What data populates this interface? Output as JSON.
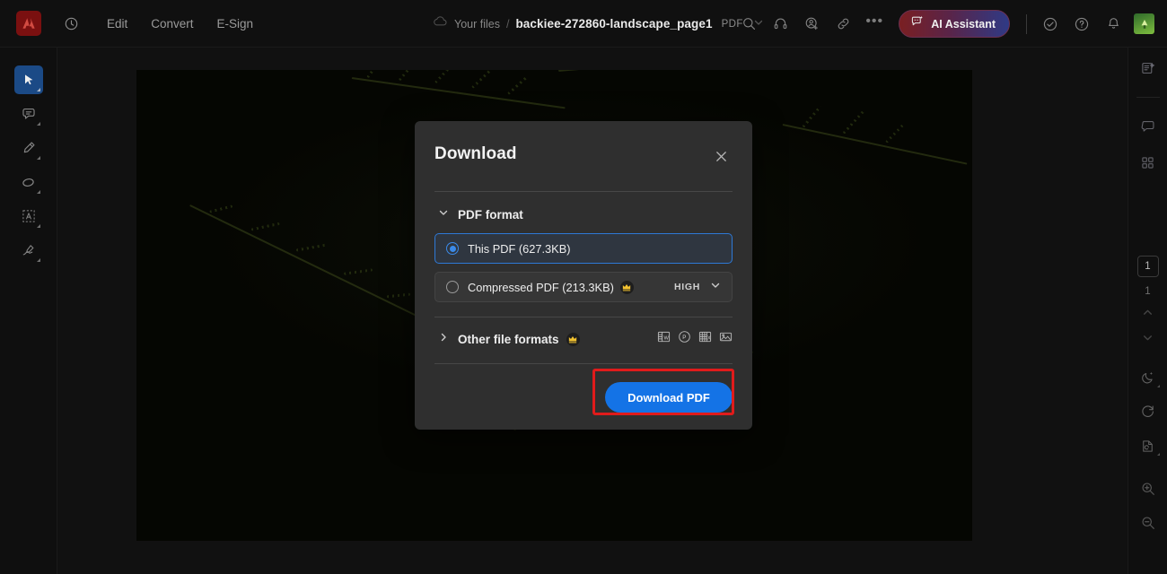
{
  "app": {
    "name": "Adobe Acrobat",
    "logo_icon": "adobe-logo-icon",
    "accent_blue": "#1473e6",
    "highlight_red": "#e01b1b",
    "modal_bg": "#2f2f2f"
  },
  "topbar": {
    "history_icon": "history-clock-icon",
    "menus": [
      {
        "label": "Edit",
        "name": "menu-edit"
      },
      {
        "label": "Convert",
        "name": "menu-convert"
      },
      {
        "label": "E-Sign",
        "name": "menu-esign"
      }
    ],
    "breadcrumb": {
      "cloud_icon": "cloud-icon",
      "root": "Your files",
      "separator": "/",
      "filename": "backiee-272860-landscape_page1",
      "filetype": "PDF",
      "chevron_icon": "chevron-down-icon"
    },
    "actions": [
      {
        "name": "search-icon",
        "icon": "search-icon"
      },
      {
        "name": "support-headset-icon",
        "icon": "headset-icon"
      },
      {
        "name": "add-person-icon",
        "icon": "person-add-icon"
      },
      {
        "name": "share-link-icon",
        "icon": "link-icon"
      },
      {
        "name": "more-options-icon",
        "icon": "ellipsis-icon",
        "label": "•••"
      }
    ],
    "ai_button": {
      "label": "AI Assistant",
      "icon": "ai-sparkle-chat-icon"
    },
    "right_actions": [
      {
        "name": "tasks-check-icon",
        "icon": "check-circle-icon"
      },
      {
        "name": "help-icon",
        "icon": "question-circle-icon"
      },
      {
        "name": "notifications-icon",
        "icon": "bell-icon"
      }
    ],
    "avatar": {
      "name": "user-avatar",
      "initial": ""
    }
  },
  "left_toolbar": {
    "tools": [
      {
        "name": "select-tool",
        "icon": "cursor-arrow-icon",
        "active": true
      },
      {
        "name": "comment-tool",
        "icon": "comment-bubble-icon",
        "active": false
      },
      {
        "name": "highlight-tool",
        "icon": "highlighter-pen-icon",
        "active": false
      },
      {
        "name": "draw-tool",
        "icon": "ellipse-draw-icon",
        "active": false
      },
      {
        "name": "text-box-tool",
        "icon": "text-box-a-icon",
        "active": false
      },
      {
        "name": "sign-tool",
        "icon": "signature-pen-icon",
        "active": false
      }
    ]
  },
  "right_toolbar": {
    "top_icons": [
      {
        "name": "organize-pages-icon",
        "icon": "page-edit-icon"
      },
      {
        "name": "comments-panel-icon",
        "icon": "comment-bubble-icon"
      },
      {
        "name": "all-tools-icon",
        "icon": "grid-apps-icon"
      }
    ],
    "page_nav": {
      "current_page": "1",
      "total_pages": "1",
      "prev_icon": "chevron-up-icon",
      "next_icon": "chevron-down-icon"
    },
    "bottom_icons": [
      {
        "name": "night-mode-icon",
        "icon": "moon-stars-icon"
      },
      {
        "name": "rotate-icon",
        "icon": "rotate-cw-icon"
      },
      {
        "name": "fit-page-icon",
        "icon": "page-fit-icon"
      },
      {
        "name": "zoom-in-icon",
        "icon": "magnifier-plus-icon"
      },
      {
        "name": "zoom-out-icon",
        "icon": "magnifier-minus-icon"
      }
    ]
  },
  "document": {
    "name": "pdf-page-preview",
    "description": "Dark photograph of fern fronds"
  },
  "modal": {
    "title": "Download",
    "close_icon": "close-x-icon",
    "section": {
      "expand_icon": "chevron-down-icon",
      "label": "PDF format"
    },
    "options": [
      {
        "name": "option-this-pdf",
        "label": "This PDF (627.3KB)",
        "selected": true,
        "premium": false
      },
      {
        "name": "option-compressed-pdf",
        "label": "Compressed PDF (213.3KB)",
        "selected": false,
        "premium": true,
        "premium_icon": "crown-icon",
        "quality": "HIGH",
        "quality_chevron": "chevron-down-icon"
      }
    ],
    "other_formats": {
      "name": "other-file-formats",
      "expand_icon": "chevron-right-icon",
      "label": "Other file formats",
      "premium_icon": "crown-icon",
      "format_icons": [
        {
          "name": "word-format-icon",
          "letter": "W"
        },
        {
          "name": "powerpoint-format-icon",
          "letter": "P"
        },
        {
          "name": "excel-format-icon",
          "letter": "X"
        },
        {
          "name": "image-format-icon",
          "letter": ""
        }
      ]
    },
    "primary_button": {
      "name": "download-pdf-button",
      "label": "Download PDF"
    }
  }
}
